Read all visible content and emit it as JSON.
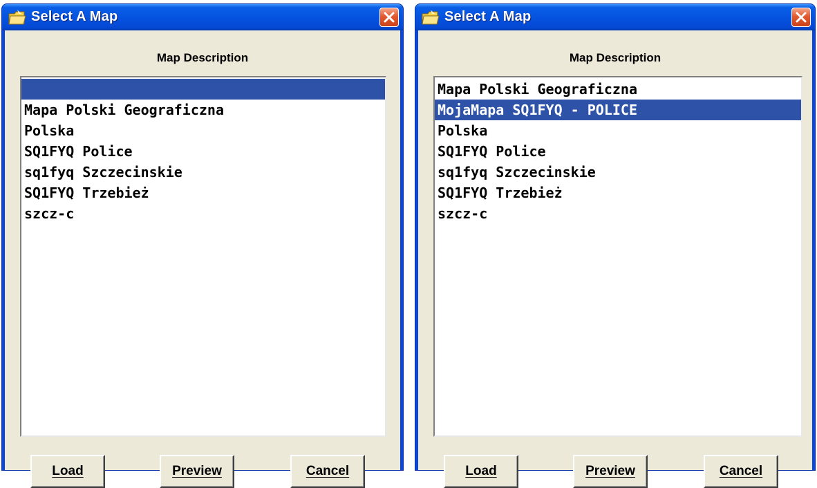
{
  "dialogs": [
    {
      "title": "Select A Map",
      "list_header": "Map Description",
      "items": [
        {
          "label": "",
          "selected": true
        },
        {
          "label": "Mapa Polski Geograficzna",
          "selected": false
        },
        {
          "label": "Polska",
          "selected": false
        },
        {
          "label": "SQ1FYQ Police",
          "selected": false
        },
        {
          "label": "sq1fyq Szczecinskie",
          "selected": false
        },
        {
          "label": "SQ1FYQ Trzebież",
          "selected": false
        },
        {
          "label": "szcz-c",
          "selected": false
        }
      ],
      "buttons": {
        "load": "Load",
        "preview": "Preview",
        "cancel": "Cancel"
      }
    },
    {
      "title": "Select A Map",
      "list_header": "Map Description",
      "items": [
        {
          "label": "Mapa Polski Geograficzna",
          "selected": false
        },
        {
          "label": "MojaMapa SQ1FYQ - POLICE",
          "selected": true
        },
        {
          "label": "Polska",
          "selected": false
        },
        {
          "label": "SQ1FYQ Police",
          "selected": false
        },
        {
          "label": "sq1fyq Szczecinskie",
          "selected": false
        },
        {
          "label": "SQ1FYQ Trzebież",
          "selected": false
        },
        {
          "label": "szcz-c",
          "selected": false
        }
      ],
      "buttons": {
        "load": "Load",
        "preview": "Preview",
        "cancel": "Cancel"
      }
    }
  ],
  "icons": {
    "title": "folder-map-icon",
    "close": "close-icon"
  },
  "colors": {
    "titlebar": "#0553e0",
    "selection": "#2d52a8",
    "dialog_face": "#ece9d8",
    "close_button": "#e25a2e"
  }
}
